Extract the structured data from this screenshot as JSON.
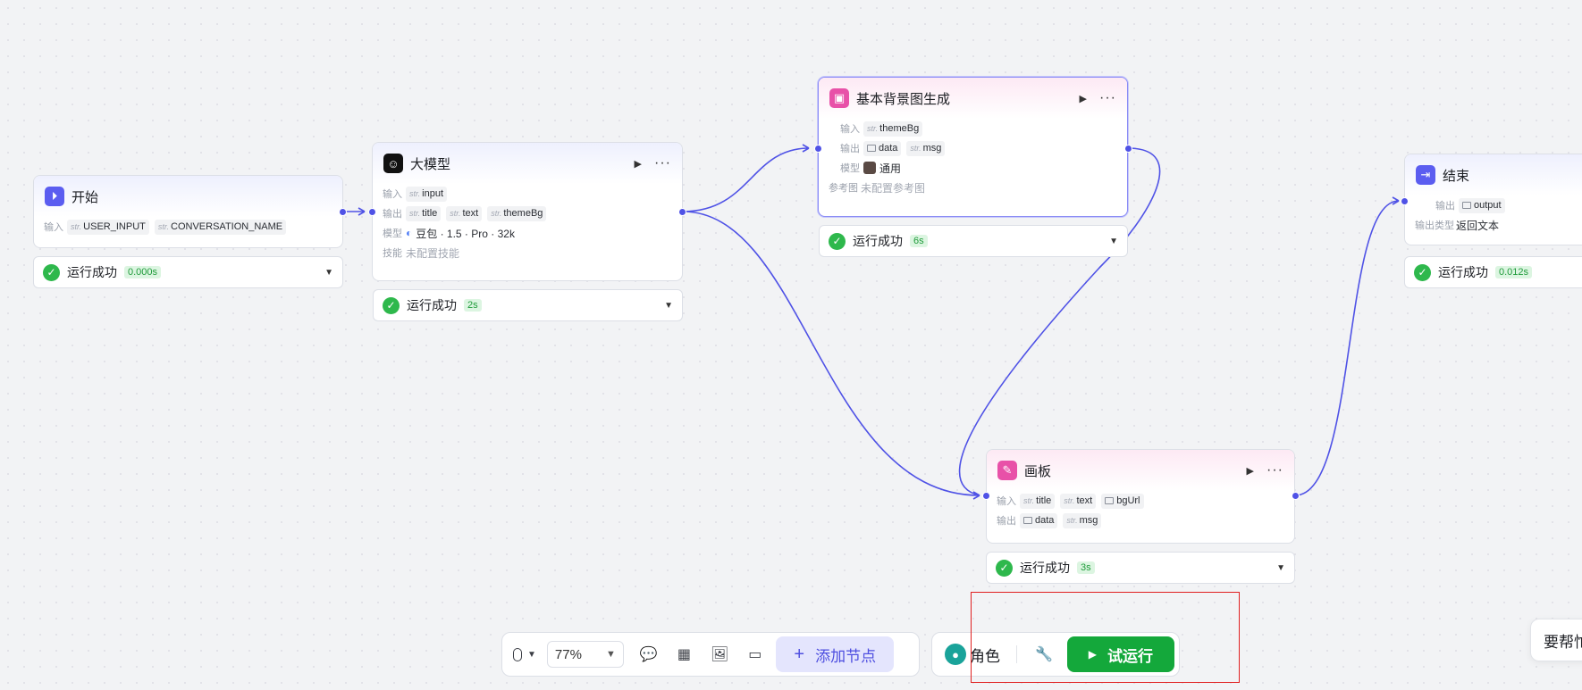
{
  "nodes": {
    "start": {
      "title": "开始",
      "input_label": "输入",
      "inputs": [
        {
          "type": "str",
          "name": "USER_INPUT"
        },
        {
          "type": "str",
          "name": "CONVERSATION_NAME"
        }
      ],
      "status": "运行成功",
      "time": "0.000s"
    },
    "llm": {
      "title": "大模型",
      "input_label": "输入",
      "output_label": "输出",
      "model_label": "模型",
      "skill_label": "技能",
      "inputs": [
        {
          "type": "str",
          "name": "input"
        }
      ],
      "outputs": [
        {
          "type": "str",
          "name": "title"
        },
        {
          "type": "str",
          "name": "text"
        },
        {
          "type": "str",
          "name": "themeBg"
        }
      ],
      "model": "豆包 · 1.5 · Pro · 32k",
      "skill": "未配置技能",
      "status": "运行成功",
      "time": "2s"
    },
    "bg": {
      "title": "基本背景图生成",
      "input_label": "输入",
      "output_label": "输出",
      "model_label": "模型",
      "ref_label": "参考图",
      "inputs": [
        {
          "type": "str",
          "name": "themeBg"
        }
      ],
      "outputs": [
        {
          "type": "img",
          "name": "data"
        },
        {
          "type": "str",
          "name": "msg"
        }
      ],
      "model": "通用",
      "ref": "未配置参考图",
      "status": "运行成功",
      "time": "6s"
    },
    "canvas": {
      "title": "画板",
      "input_label": "输入",
      "output_label": "输出",
      "inputs": [
        {
          "type": "str",
          "name": "title"
        },
        {
          "type": "str",
          "name": "text"
        },
        {
          "type": "img",
          "name": "bgUrl"
        }
      ],
      "outputs": [
        {
          "type": "img",
          "name": "data"
        },
        {
          "type": "str",
          "name": "msg"
        }
      ],
      "status": "运行成功",
      "time": "3s"
    },
    "end": {
      "title": "结束",
      "output_label": "输出",
      "output_type_label": "输出类型",
      "outputs": [
        {
          "type": "img",
          "name": "output"
        }
      ],
      "output_type": "返回文本",
      "status": "运行成功",
      "time": "0.012s"
    }
  },
  "type_labels": {
    "str": "str."
  },
  "toolbar": {
    "zoom": "77%",
    "add_node": "添加节点",
    "role": "角色",
    "test_run": "试运行"
  },
  "help": {
    "label": "要帮忙"
  },
  "colors": {
    "accent": "#4f52e6",
    "success": "#2eb84c",
    "run": "#14a83b"
  }
}
